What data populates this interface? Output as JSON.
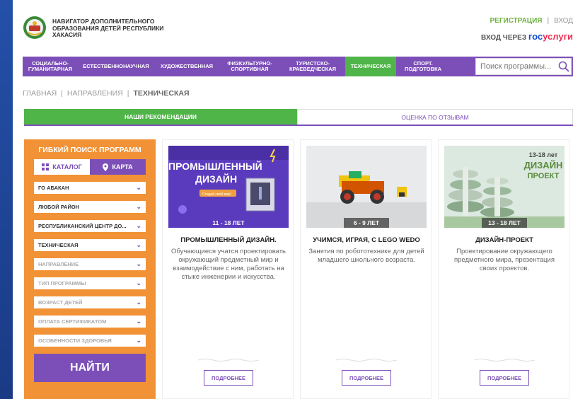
{
  "header": {
    "brand_line1": "НАВИГАТОР ДОПОЛНИТЕЛЬНОГО",
    "brand_line2": "ОБРАЗОВАНИЯ ДЕТЕЙ РЕСПУБЛИКИ",
    "brand_line3": "ХАКАСИЯ",
    "register": "РЕГИСТРАЦИЯ",
    "separator": "|",
    "login": "ВХОД",
    "gos_prefix": "ВХОД ЧЕРЕЗ",
    "gos_part1": "гос",
    "gos_part2": "услуги"
  },
  "nav": {
    "items": [
      {
        "label_1": "СОЦИАЛЬНО-",
        "label_2": "ГУМАНИТАРНАЯ"
      },
      {
        "label_1": "ЕСТЕСТВЕННОНАУЧНАЯ",
        "label_2": ""
      },
      {
        "label_1": "ХУДОЖЕСТВЕННАЯ",
        "label_2": ""
      },
      {
        "label_1": "ФИЗКУЛЬТУРНО-",
        "label_2": "СПОРТИВНАЯ"
      },
      {
        "label_1": "ТУРИСТСКО-",
        "label_2": "КРАЕВЕДЧЕСКАЯ"
      },
      {
        "label_1": "ТЕХНИЧЕСКАЯ",
        "label_2": ""
      },
      {
        "label_1": "СПОРТ.",
        "label_2": "ПОДГОТОВКА"
      }
    ],
    "active_index": 5,
    "search_placeholder": "Поиск программы..."
  },
  "breadcrumb": {
    "home": "ГЛАВНАЯ",
    "sep": "|",
    "section": "НАПРАВЛЕНИЯ",
    "current": "ТЕХНИЧЕСКАЯ"
  },
  "tabs": {
    "recommendations": "НАШИ РЕКОМЕНДАЦИИ",
    "reviews": "ОЦЕНКА ПО ОТЗЫВАМ"
  },
  "filter": {
    "title": "ГИБКИЙ ПОИСК ПРОГРАММ",
    "catalog": "КАТАЛОГ",
    "map": "КАРТА",
    "selects": [
      {
        "value": "ГО АБАКАН",
        "dim": false
      },
      {
        "value": "ЛЮБОЙ РАЙОН",
        "dim": false
      },
      {
        "value": "РЕСПУБЛИКАНСКИЙ ЦЕНТР ДО...",
        "dim": false
      },
      {
        "value": "ТЕХНИЧЕСКАЯ",
        "dim": false
      },
      {
        "value": "НАПРАВЛЕНИЕ",
        "dim": true
      },
      {
        "value": "ТИП ПРОГРАММЫ",
        "dim": true
      },
      {
        "value": "ВОЗРАСТ ДЕТЕЙ",
        "dim": true
      },
      {
        "value": "ОПЛАТА СЕРТИФИКАТОМ",
        "dim": true
      },
      {
        "value": "ОСОБЕННОСТИ ЗДОРОВЬЯ",
        "dim": true
      }
    ],
    "find": "НАЙТИ"
  },
  "cards": [
    {
      "age": "11 - 18 ЛЕТ",
      "title": "ПРОМЫШЛЕННЫЙ ДИЗАЙН.",
      "description": "Обучающиеся учатся проектировать окружающий предметный мир и взаимодействие с ним, работать на стыке инженерии и искусства.",
      "more": "ПОДРОБНЕЕ",
      "poster_line1": "ПРОМЫШЛЕННЫЙ",
      "poster_line2": "ДИЗАЙН",
      "poster_line3": "Создай свой мир!"
    },
    {
      "age": "6 - 9 ЛЕТ",
      "title": "УЧИМСЯ, ИГРАЯ, С LEGO WEDO",
      "description": "Занятия по робототехнике для детей младшего школьного возраста.",
      "more": "ПОДРОБНЕЕ"
    },
    {
      "age": "13 - 18 ЛЕТ",
      "title": "ДИЗАЙН-ПРОЕКТ",
      "description": "Проектирование окружающего предметного мира, презентация своих проектов.",
      "more": "ПОДРОБНЕЕ",
      "poster_line1": "13-18 лет",
      "poster_line2": "ДИЗАЙН",
      "poster_line3": "ПРОЕКТ"
    }
  ],
  "colors": {
    "purple": "#7c4fb8",
    "green": "#4fb548",
    "orange": "#f29236",
    "background_blue": "#1c3f8a"
  }
}
